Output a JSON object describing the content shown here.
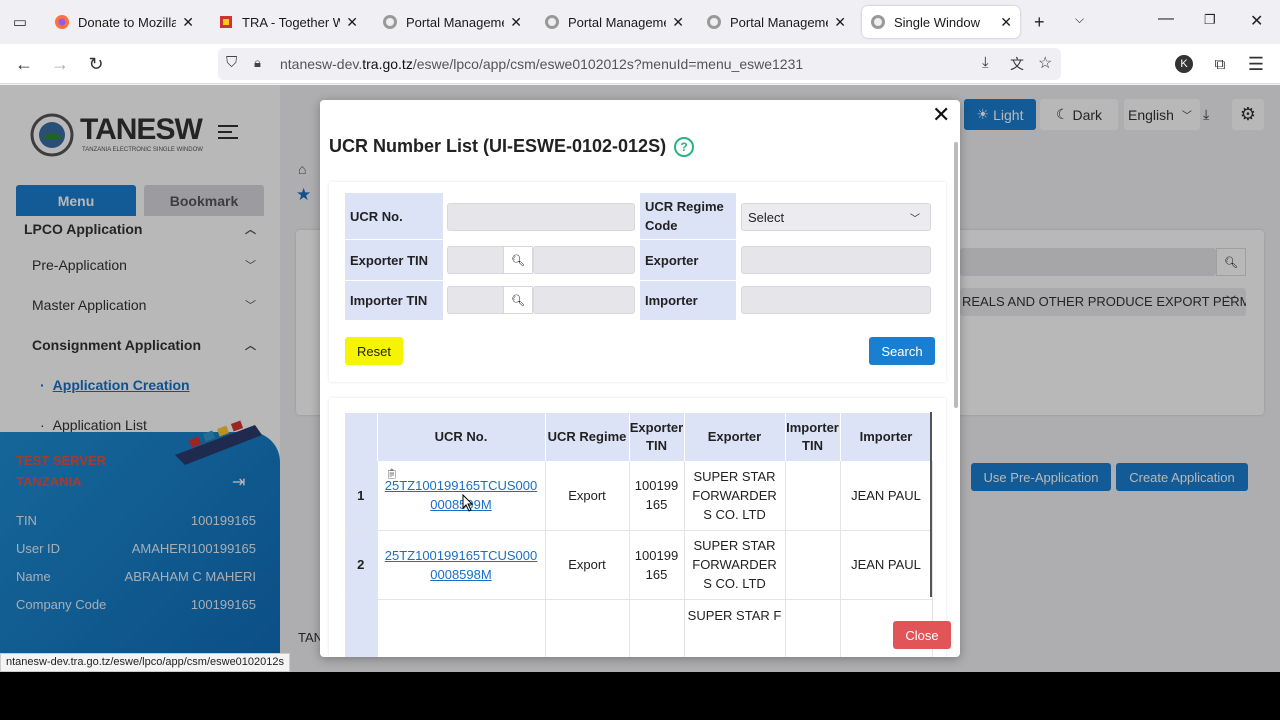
{
  "browser": {
    "tabs": [
      {
        "title": "Donate to Mozilla F",
        "active": false
      },
      {
        "title": "TRA - Together We B",
        "active": false
      },
      {
        "title": "Portal Management",
        "active": false
      },
      {
        "title": "Portal Management",
        "active": false
      },
      {
        "title": "Portal Management",
        "active": false
      },
      {
        "title": "Single Window",
        "active": true
      }
    ],
    "url_prefix": "ntanesw-dev.",
    "url_domain": "tra.go.tz",
    "url_path": "/eswe/lpco/app/csm/eswe0102012s?menuId=menu_eswe1231",
    "status_url": "ntanesw-dev.tra.go.tz/eswe/lpco/app/csm/eswe0102012s",
    "profile_initial": "K"
  },
  "header": {
    "theme_light": "Light",
    "theme_dark": "Dark",
    "language": "English"
  },
  "sidebar": {
    "logo_text": "TANESW",
    "logo_sub": "TANZANIA ELECTRONIC SINGLE WINDOW",
    "tab_menu": "Menu",
    "tab_bookmark": "Bookmark",
    "items": [
      {
        "label": "LPCO Application"
      },
      {
        "label": "Pre-Application"
      },
      {
        "label": "Master Application"
      },
      {
        "label": "Consignment Application"
      },
      {
        "label": "Application Creation"
      },
      {
        "label": "Application List"
      }
    ],
    "profile": {
      "server_label": "TEST SERVER TANZANIA",
      "rows": [
        {
          "key": "TIN",
          "value": "100199165"
        },
        {
          "key": "User ID",
          "value": "AMAHERI100199165"
        },
        {
          "key": "Name",
          "value": "ABRAHAM C MAHERI"
        },
        {
          "key": "Company Code",
          "value": "100199165"
        }
      ]
    }
  },
  "background": {
    "select_text": "REALS AND OTHER PRODUCE EXPORT PERM",
    "btn_pre_app": "Use Pre-Application",
    "btn_create_app": "Create Application",
    "footer_text": "TAN"
  },
  "modal": {
    "title": "UCR Number List (UI-ESWE-0102-012S)",
    "filter": {
      "ucr_no_label": "UCR No.",
      "ucr_regime_label": "UCR Regime Code",
      "ucr_regime_value": "Select",
      "exporter_tin_label": "Exporter TIN",
      "exporter_label": "Exporter",
      "importer_tin_label": "Importer TIN",
      "importer_label": "Importer",
      "reset_label": "Reset",
      "search_label": "Search"
    },
    "table": {
      "headers": [
        "UCR No.",
        "UCR Regime",
        "Exporter TIN",
        "Exporter",
        "Importer TIN",
        "Importer"
      ],
      "rows": [
        {
          "num": "1",
          "ucr": "25TZ100199165TCUS0000008599M",
          "regime": "Export",
          "exporter_tin": "100199165",
          "exporter": "SUPER STAR FORWARDERS CO. LTD",
          "importer_tin": "",
          "importer": "JEAN PAUL"
        },
        {
          "num": "2",
          "ucr": "25TZ100199165TCUS0000008598M",
          "regime": "Export",
          "exporter_tin": "100199165",
          "exporter": "SUPER STAR FORWARDERS CO. LTD",
          "importer_tin": "",
          "importer": "JEAN PAUL"
        },
        {
          "num": "",
          "ucr": "",
          "regime": "",
          "exporter_tin": "",
          "exporter": "SUPER STAR F",
          "importer_tin": "",
          "importer": ""
        }
      ]
    },
    "close_label": "Close"
  },
  "colors": {
    "accent_blue": "#1a7fd0",
    "reset_yellow": "#f5f500",
    "close_red": "#e15558",
    "label_bg": "#dde3f6"
  }
}
